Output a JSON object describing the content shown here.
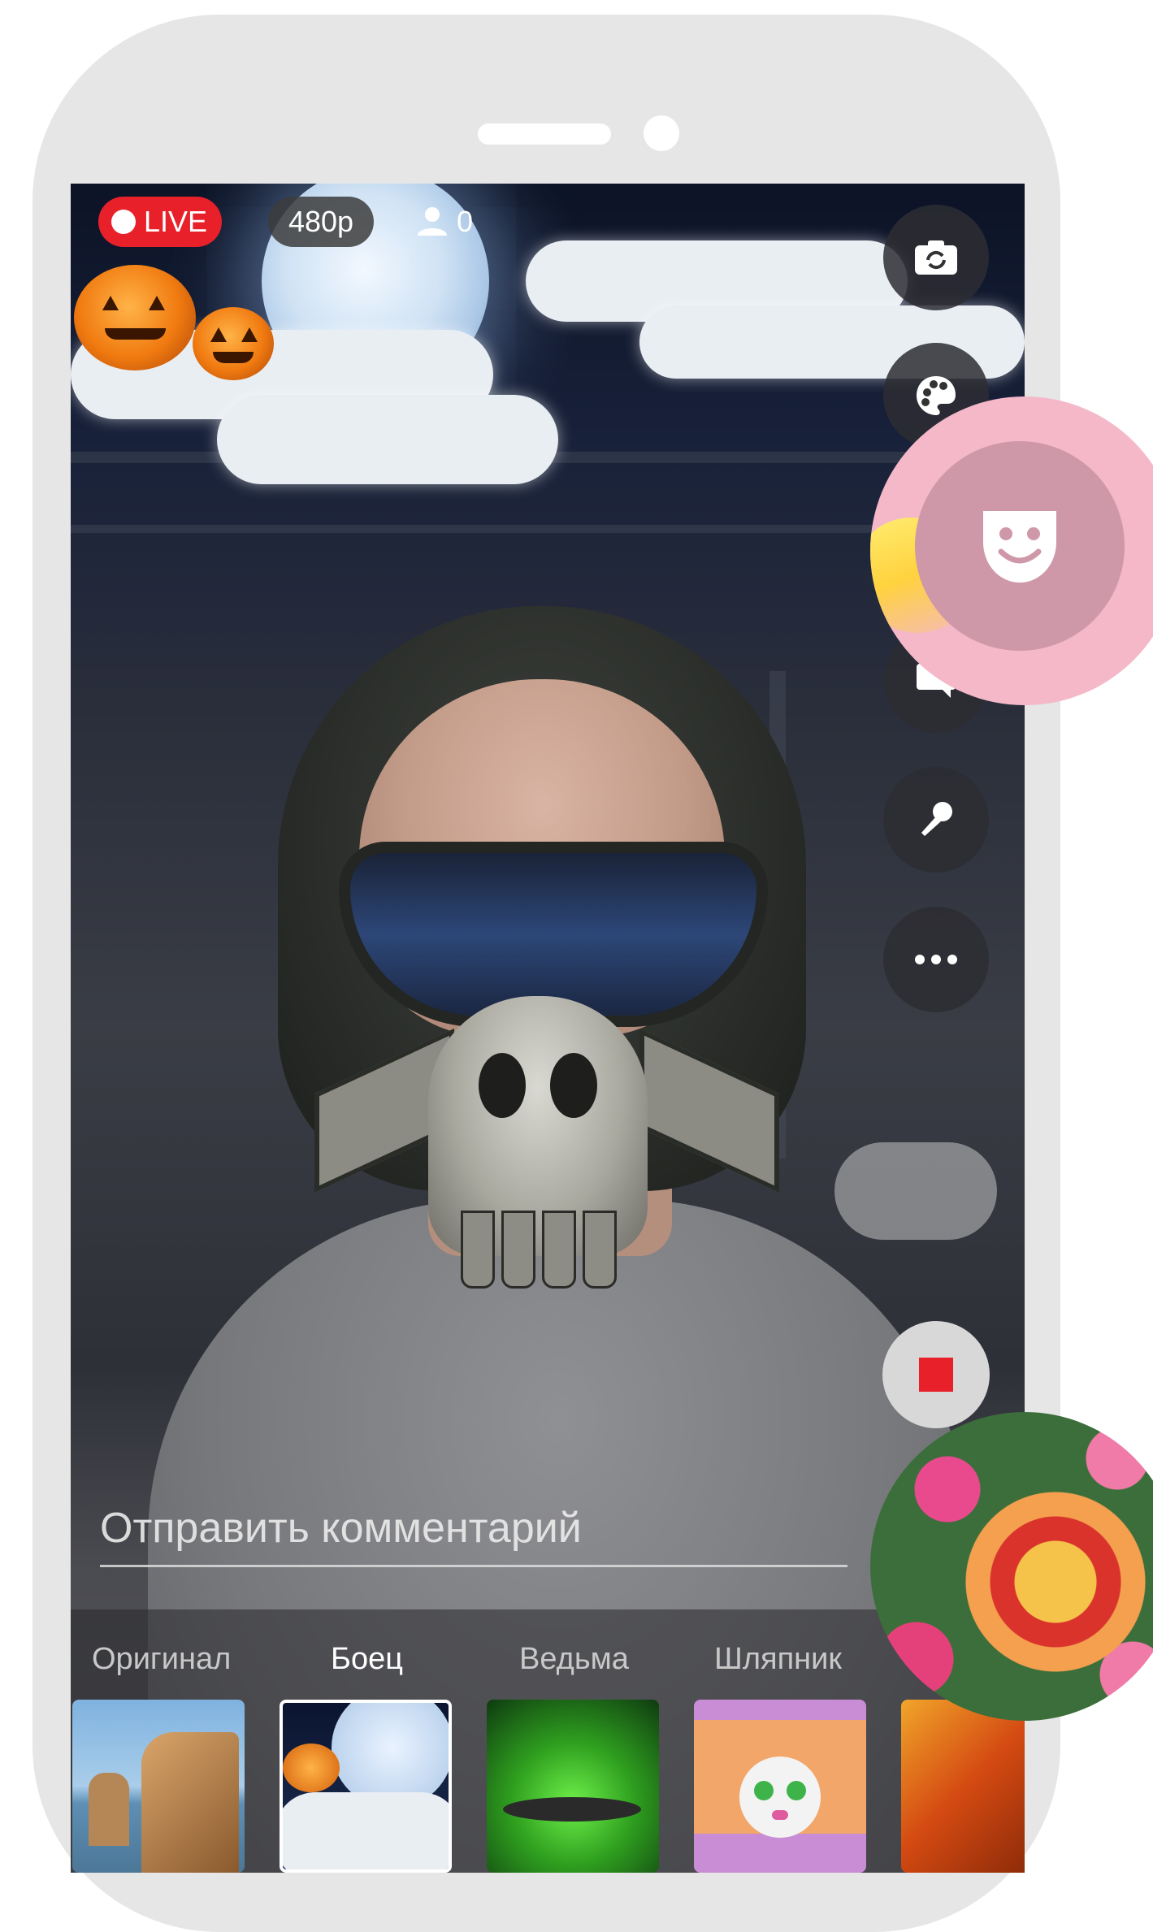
{
  "top_bar": {
    "live_label": "LIVE",
    "quality": "480p",
    "viewer_count": "0"
  },
  "side_buttons": [
    "switch-camera-icon",
    "palette-icon",
    "mask-icon",
    "chat-icon",
    "microphone-icon",
    "more-icon"
  ],
  "comment": {
    "placeholder": "Отправить комментарий"
  },
  "filters": [
    {
      "label": "Оригинал",
      "active": false
    },
    {
      "label": "Боец",
      "active": true
    },
    {
      "label": "Ведьма",
      "active": false
    },
    {
      "label": "Шляпник",
      "active": false
    }
  ],
  "colors": {
    "live_red": "#e8202a",
    "mask_highlight": "#f4b8c9",
    "phone_frame": "#e6e6e6"
  }
}
